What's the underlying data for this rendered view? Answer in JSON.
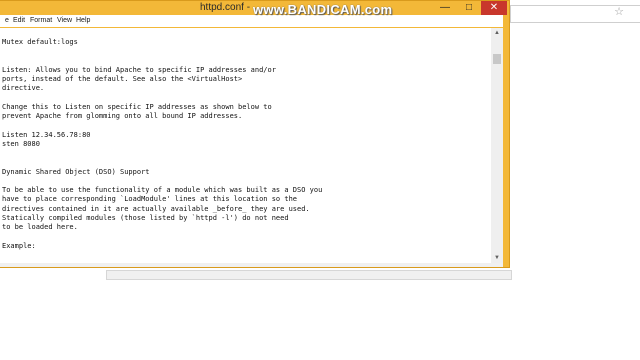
{
  "window": {
    "title": "httpd.conf - ",
    "controls": {
      "minimize": "—",
      "maximize": "□",
      "close": "✕"
    }
  },
  "menu": {
    "file": "e",
    "edit": "Edit",
    "format": "Format",
    "view": "View",
    "help": "Help"
  },
  "editor": {
    "lines": [
      "Mutex default:logs",
      "",
      "",
      "Listen: Allows you to bind Apache to specific IP addresses and/or",
      "ports, instead of the default. See also the <VirtualHost>",
      "directive.",
      "",
      "Change this to Listen on specific IP addresses as shown below to",
      "prevent Apache from glomming onto all bound IP addresses.",
      "",
      "Listen 12.34.56.78:80",
      "sten 8080",
      "",
      "",
      "Dynamic Shared Object (DSO) Support",
      "",
      "To be able to use the functionality of a module which was built as a DSO you",
      "have to place corresponding `LoadModule' lines at this location so the",
      "directives contained in it are actually available _before_ they are used.",
      "Statically compiled modules (those listed by `httpd -l') do not need",
      "to be loaded here.",
      "",
      "Example:"
    ]
  },
  "watermark": {
    "brand": "www.BANDICAM.com"
  },
  "colors": {
    "title_bar": "#f3b838",
    "close_button": "#c8372c"
  },
  "icons": {
    "scroll_up": "arrow-up-icon",
    "scroll_down": "arrow-down-icon",
    "star": "star-icon"
  }
}
